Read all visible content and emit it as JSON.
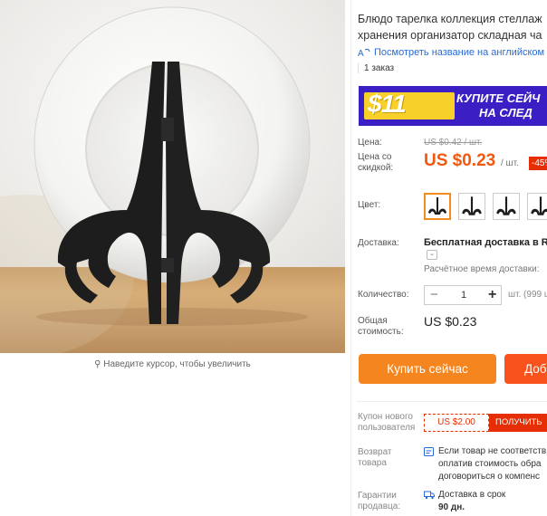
{
  "gallery": {
    "zoom_hint": "Наведите курсор, чтобы увеличить"
  },
  "product": {
    "title_line1": "Блюдо тарелка коллекция стеллаж",
    "title_line2": "хранения организатор складная ча",
    "translate_link": "Посмотреть название на английском",
    "orders": "1 заказ"
  },
  "banner": {
    "price": "$11",
    "line1": "КУПИТЕ СЕЙЧ",
    "line2": "НА СЛЕД",
    "colors": {
      "background": "#3b1fc4",
      "plate": "#f7d12a"
    }
  },
  "pricing": {
    "price_label": "Цена:",
    "original_price": "US $0.42 / шт.",
    "discount_label_line1": "Цена со",
    "discount_label_line2": "скидкой:",
    "discount_price": "US $0.23",
    "per_unit": "/ шт.",
    "discount_badge": "-45%",
    "accent_color": "#f3570e"
  },
  "color": {
    "label": "Цвет:",
    "swatches": [
      {
        "name": "stand-black-1",
        "selected": true
      },
      {
        "name": "stand-black-2",
        "selected": false
      },
      {
        "name": "stand-black-3",
        "selected": false
      },
      {
        "name": "stand-black-4",
        "selected": false
      }
    ]
  },
  "shipping": {
    "label": "Доставка:",
    "title": "Бесплатная доставка в Rus",
    "estimate": "Расчётное время доставки:"
  },
  "quantity": {
    "label": "Количество:",
    "minus": "−",
    "value": "1",
    "plus": "+",
    "available": "шт. (999 ш"
  },
  "total": {
    "label_line1": "Общая",
    "label_line2": "стоимость:",
    "value": "US $0.23"
  },
  "actions": {
    "buy_now": "Купить сейчас",
    "add_to_cart": "Доб"
  },
  "coupon": {
    "label_line1": "Купон нового",
    "label_line2": "пользователя",
    "value": "US $2.00",
    "get_label": "ПОЛУЧИТЬ"
  },
  "returns": {
    "label_line1": "Возврат",
    "label_line2": "товара",
    "line1": "Если товар не соответств",
    "line2": "оплатив стоимость обра",
    "line3": "договориться о компенс"
  },
  "guarantee": {
    "label_line1": "Гарантии",
    "label_line2": "продавца:",
    "line1": "Доставка в срок",
    "line2": "90 дн."
  }
}
